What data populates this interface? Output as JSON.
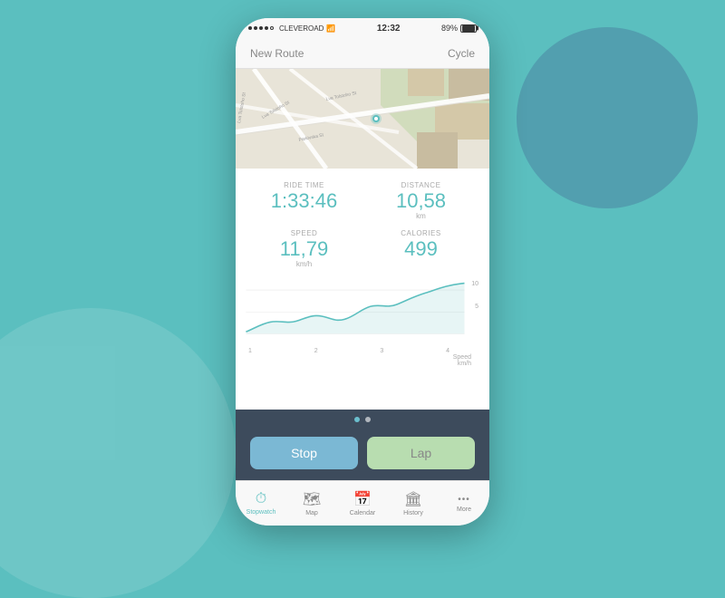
{
  "background": {
    "color": "#5bbfbf"
  },
  "statusBar": {
    "carrier": "CLEVEROAD",
    "time": "12:32",
    "battery": "89%"
  },
  "navBar": {
    "title": "New Route",
    "mode": "Cycle"
  },
  "stats": {
    "rideTime": {
      "label": "RIDE TIME",
      "value": "1:33:46",
      "unit": ""
    },
    "distance": {
      "label": "DISTANCE",
      "value": "10,58",
      "unit": "km"
    },
    "speed": {
      "label": "SPEED",
      "value": "11,79",
      "unit": "km/h"
    },
    "calories": {
      "label": "CALORIES",
      "value": "499",
      "unit": ""
    }
  },
  "chart": {
    "xLabels": [
      "1",
      "2",
      "3",
      "4"
    ],
    "yLabels": [
      "10",
      "5"
    ],
    "speedLabel": "Speed\nkm/h"
  },
  "pageDots": {
    "active": 0,
    "count": 2
  },
  "buttons": {
    "stop": "Stop",
    "lap": "Lap"
  },
  "tabs": [
    {
      "label": "Stopwatch",
      "icon": "⏱",
      "active": true
    },
    {
      "label": "Map",
      "icon": "🗺",
      "active": false
    },
    {
      "label": "Calendar",
      "icon": "📅",
      "active": false
    },
    {
      "label": "History",
      "icon": "🏛",
      "active": false
    },
    {
      "label": "More",
      "icon": "•••",
      "active": false
    }
  ]
}
